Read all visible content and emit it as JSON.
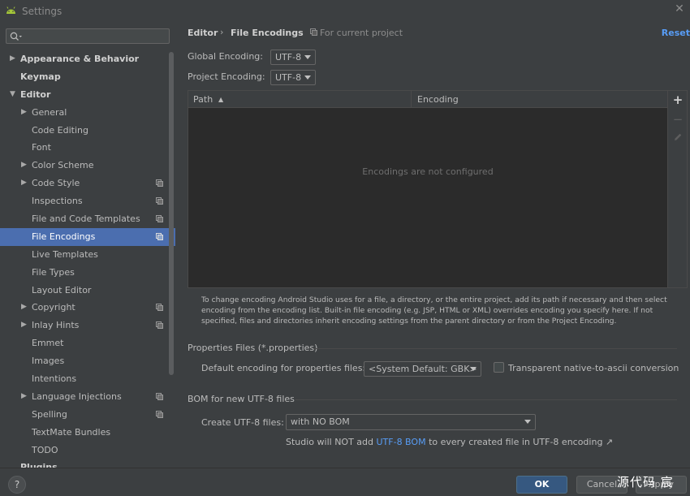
{
  "window": {
    "title": "Settings"
  },
  "search": {
    "placeholder": ""
  },
  "sidebar": {
    "items": [
      {
        "label": "Appearance & Behavior",
        "arrow": "▶"
      },
      {
        "label": "Keymap",
        "arrow": ""
      },
      {
        "label": "Editor",
        "arrow": "▼"
      },
      {
        "label": "General",
        "arrow": "▶"
      },
      {
        "label": "Code Editing",
        "arrow": ""
      },
      {
        "label": "Font",
        "arrow": ""
      },
      {
        "label": "Color Scheme",
        "arrow": "▶"
      },
      {
        "label": "Code Style",
        "arrow": "▶"
      },
      {
        "label": "Inspections",
        "arrow": ""
      },
      {
        "label": "File and Code Templates",
        "arrow": ""
      },
      {
        "label": "File Encodings",
        "arrow": ""
      },
      {
        "label": "Live Templates",
        "arrow": ""
      },
      {
        "label": "File Types",
        "arrow": ""
      },
      {
        "label": "Layout Editor",
        "arrow": ""
      },
      {
        "label": "Copyright",
        "arrow": "▶"
      },
      {
        "label": "Inlay Hints",
        "arrow": "▶"
      },
      {
        "label": "Emmet",
        "arrow": ""
      },
      {
        "label": "Images",
        "arrow": ""
      },
      {
        "label": "Intentions",
        "arrow": ""
      },
      {
        "label": "Language Injections",
        "arrow": "▶"
      },
      {
        "label": "Spelling",
        "arrow": ""
      },
      {
        "label": "TextMate Bundles",
        "arrow": ""
      },
      {
        "label": "TODO",
        "arrow": ""
      },
      {
        "label": "Plugins",
        "arrow": ""
      }
    ]
  },
  "breadcrumb": {
    "parent": "Editor",
    "separator": "›",
    "current": "File Encodings"
  },
  "scope_label": "For current project",
  "reset_label": "Reset",
  "global_encoding": {
    "label": "Global Encoding:",
    "value": "UTF-8"
  },
  "project_encoding": {
    "label": "Project Encoding:",
    "value": "UTF-8"
  },
  "table": {
    "columns": {
      "path": "Path",
      "sort_icon": "▲",
      "encoding": "Encoding"
    },
    "empty_text": "Encodings are not configured"
  },
  "toolbar": {
    "add": "+",
    "remove": "−"
  },
  "description": "To change encoding Android Studio uses for a file, a directory, or the entire project, add its path if necessary and then select encoding from the encoding list. Built-in file encoding (e.g. JSP, HTML or XML) overrides encoding you specify here. If not specified, files and directories inherit encoding settings from the parent directory or from the Project Encoding.",
  "properties": {
    "section_title": "Properties Files (*.properties)",
    "default_label": "Default encoding for properties files:",
    "default_value": "<System Default: GBK>",
    "transparent_label": "Transparent native-to-ascii conversion"
  },
  "bom": {
    "section_title": "BOM for new UTF-8 files",
    "create_label": "Create UTF-8 files:",
    "create_value": "with NO BOM",
    "note_prefix": "Studio will NOT add ",
    "note_link": "UTF-8 BOM",
    "note_suffix": " to every created file in UTF-8 encoding ↗"
  },
  "footer": {
    "help": "?",
    "ok": "OK",
    "cancel": "Cancel",
    "apply": "Apply"
  },
  "watermark": "源代码  宸",
  "colors": {
    "accent": "#4b6eaf",
    "link": "#589df6",
    "ok_button": "#365880"
  }
}
